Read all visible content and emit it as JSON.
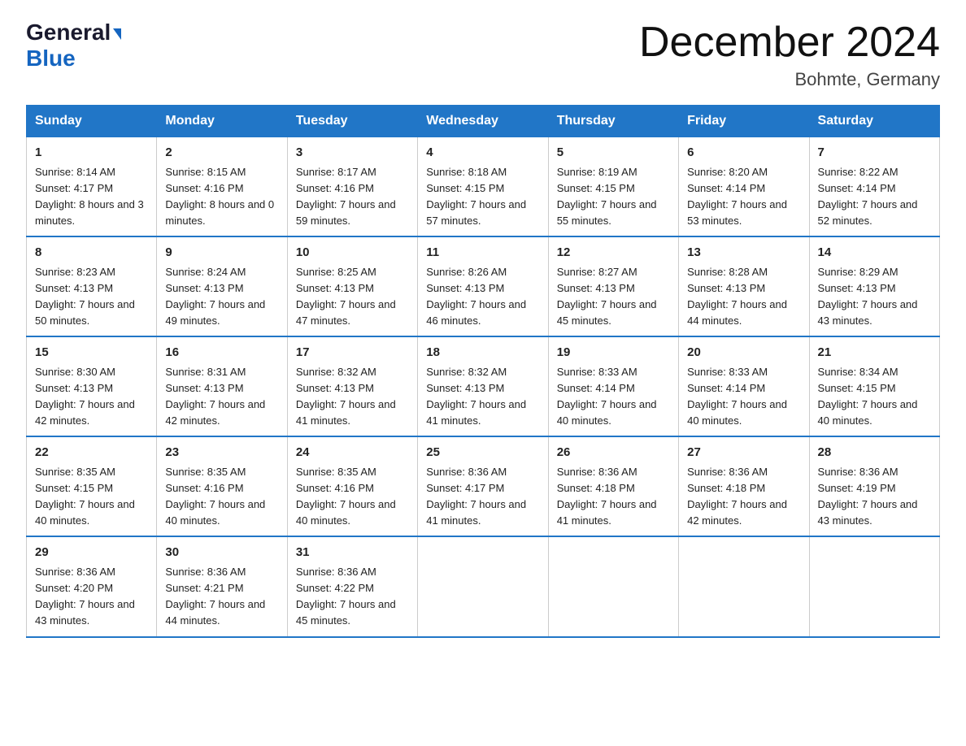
{
  "logo": {
    "general": "General",
    "blue": "Blue"
  },
  "title": "December 2024",
  "location": "Bohmte, Germany",
  "days_of_week": [
    "Sunday",
    "Monday",
    "Tuesday",
    "Wednesday",
    "Thursday",
    "Friday",
    "Saturday"
  ],
  "weeks": [
    [
      {
        "day": "1",
        "sunrise": "Sunrise: 8:14 AM",
        "sunset": "Sunset: 4:17 PM",
        "daylight": "Daylight: 8 hours and 3 minutes."
      },
      {
        "day": "2",
        "sunrise": "Sunrise: 8:15 AM",
        "sunset": "Sunset: 4:16 PM",
        "daylight": "Daylight: 8 hours and 0 minutes."
      },
      {
        "day": "3",
        "sunrise": "Sunrise: 8:17 AM",
        "sunset": "Sunset: 4:16 PM",
        "daylight": "Daylight: 7 hours and 59 minutes."
      },
      {
        "day": "4",
        "sunrise": "Sunrise: 8:18 AM",
        "sunset": "Sunset: 4:15 PM",
        "daylight": "Daylight: 7 hours and 57 minutes."
      },
      {
        "day": "5",
        "sunrise": "Sunrise: 8:19 AM",
        "sunset": "Sunset: 4:15 PM",
        "daylight": "Daylight: 7 hours and 55 minutes."
      },
      {
        "day": "6",
        "sunrise": "Sunrise: 8:20 AM",
        "sunset": "Sunset: 4:14 PM",
        "daylight": "Daylight: 7 hours and 53 minutes."
      },
      {
        "day": "7",
        "sunrise": "Sunrise: 8:22 AM",
        "sunset": "Sunset: 4:14 PM",
        "daylight": "Daylight: 7 hours and 52 minutes."
      }
    ],
    [
      {
        "day": "8",
        "sunrise": "Sunrise: 8:23 AM",
        "sunset": "Sunset: 4:13 PM",
        "daylight": "Daylight: 7 hours and 50 minutes."
      },
      {
        "day": "9",
        "sunrise": "Sunrise: 8:24 AM",
        "sunset": "Sunset: 4:13 PM",
        "daylight": "Daylight: 7 hours and 49 minutes."
      },
      {
        "day": "10",
        "sunrise": "Sunrise: 8:25 AM",
        "sunset": "Sunset: 4:13 PM",
        "daylight": "Daylight: 7 hours and 47 minutes."
      },
      {
        "day": "11",
        "sunrise": "Sunrise: 8:26 AM",
        "sunset": "Sunset: 4:13 PM",
        "daylight": "Daylight: 7 hours and 46 minutes."
      },
      {
        "day": "12",
        "sunrise": "Sunrise: 8:27 AM",
        "sunset": "Sunset: 4:13 PM",
        "daylight": "Daylight: 7 hours and 45 minutes."
      },
      {
        "day": "13",
        "sunrise": "Sunrise: 8:28 AM",
        "sunset": "Sunset: 4:13 PM",
        "daylight": "Daylight: 7 hours and 44 minutes."
      },
      {
        "day": "14",
        "sunrise": "Sunrise: 8:29 AM",
        "sunset": "Sunset: 4:13 PM",
        "daylight": "Daylight: 7 hours and 43 minutes."
      }
    ],
    [
      {
        "day": "15",
        "sunrise": "Sunrise: 8:30 AM",
        "sunset": "Sunset: 4:13 PM",
        "daylight": "Daylight: 7 hours and 42 minutes."
      },
      {
        "day": "16",
        "sunrise": "Sunrise: 8:31 AM",
        "sunset": "Sunset: 4:13 PM",
        "daylight": "Daylight: 7 hours and 42 minutes."
      },
      {
        "day": "17",
        "sunrise": "Sunrise: 8:32 AM",
        "sunset": "Sunset: 4:13 PM",
        "daylight": "Daylight: 7 hours and 41 minutes."
      },
      {
        "day": "18",
        "sunrise": "Sunrise: 8:32 AM",
        "sunset": "Sunset: 4:13 PM",
        "daylight": "Daylight: 7 hours and 41 minutes."
      },
      {
        "day": "19",
        "sunrise": "Sunrise: 8:33 AM",
        "sunset": "Sunset: 4:14 PM",
        "daylight": "Daylight: 7 hours and 40 minutes."
      },
      {
        "day": "20",
        "sunrise": "Sunrise: 8:33 AM",
        "sunset": "Sunset: 4:14 PM",
        "daylight": "Daylight: 7 hours and 40 minutes."
      },
      {
        "day": "21",
        "sunrise": "Sunrise: 8:34 AM",
        "sunset": "Sunset: 4:15 PM",
        "daylight": "Daylight: 7 hours and 40 minutes."
      }
    ],
    [
      {
        "day": "22",
        "sunrise": "Sunrise: 8:35 AM",
        "sunset": "Sunset: 4:15 PM",
        "daylight": "Daylight: 7 hours and 40 minutes."
      },
      {
        "day": "23",
        "sunrise": "Sunrise: 8:35 AM",
        "sunset": "Sunset: 4:16 PM",
        "daylight": "Daylight: 7 hours and 40 minutes."
      },
      {
        "day": "24",
        "sunrise": "Sunrise: 8:35 AM",
        "sunset": "Sunset: 4:16 PM",
        "daylight": "Daylight: 7 hours and 40 minutes."
      },
      {
        "day": "25",
        "sunrise": "Sunrise: 8:36 AM",
        "sunset": "Sunset: 4:17 PM",
        "daylight": "Daylight: 7 hours and 41 minutes."
      },
      {
        "day": "26",
        "sunrise": "Sunrise: 8:36 AM",
        "sunset": "Sunset: 4:18 PM",
        "daylight": "Daylight: 7 hours and 41 minutes."
      },
      {
        "day": "27",
        "sunrise": "Sunrise: 8:36 AM",
        "sunset": "Sunset: 4:18 PM",
        "daylight": "Daylight: 7 hours and 42 minutes."
      },
      {
        "day": "28",
        "sunrise": "Sunrise: 8:36 AM",
        "sunset": "Sunset: 4:19 PM",
        "daylight": "Daylight: 7 hours and 43 minutes."
      }
    ],
    [
      {
        "day": "29",
        "sunrise": "Sunrise: 8:36 AM",
        "sunset": "Sunset: 4:20 PM",
        "daylight": "Daylight: 7 hours and 43 minutes."
      },
      {
        "day": "30",
        "sunrise": "Sunrise: 8:36 AM",
        "sunset": "Sunset: 4:21 PM",
        "daylight": "Daylight: 7 hours and 44 minutes."
      },
      {
        "day": "31",
        "sunrise": "Sunrise: 8:36 AM",
        "sunset": "Sunset: 4:22 PM",
        "daylight": "Daylight: 7 hours and 45 minutes."
      },
      {
        "day": "",
        "sunrise": "",
        "sunset": "",
        "daylight": ""
      },
      {
        "day": "",
        "sunrise": "",
        "sunset": "",
        "daylight": ""
      },
      {
        "day": "",
        "sunrise": "",
        "sunset": "",
        "daylight": ""
      },
      {
        "day": "",
        "sunrise": "",
        "sunset": "",
        "daylight": ""
      }
    ]
  ]
}
